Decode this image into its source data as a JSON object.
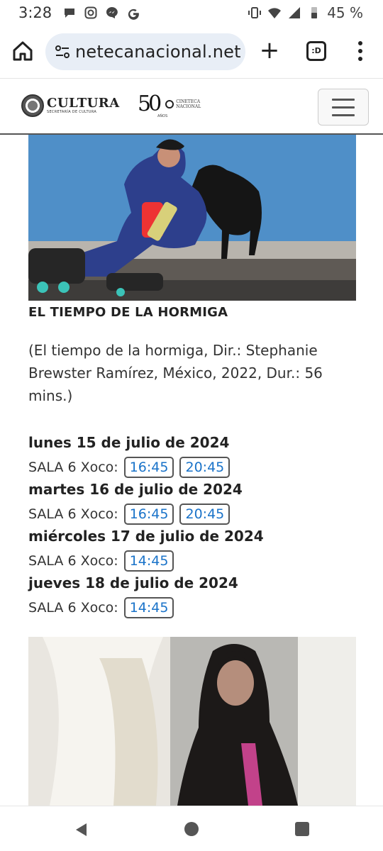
{
  "status_bar": {
    "time": "3:28",
    "left_icons": [
      "chat-bubble-icon",
      "instagram-icon",
      "messenger-icon",
      "google-icon"
    ],
    "battery": "45 %",
    "right_icons": [
      "vibrate-icon",
      "wifi-icon",
      "signal-icon",
      "battery-icon"
    ]
  },
  "browser": {
    "url": "netecanacional.net",
    "tabs_label": ":D"
  },
  "site_header": {
    "logo_main": "CULTURA",
    "logo_sub": "SECRETARÍA DE CULTURA",
    "fifty": "50",
    "anos": "AÑOS",
    "cineteca_line1": "CINETECA",
    "cineteca_line2": "NACIONAL"
  },
  "film": {
    "title": "EL TIEMPO DE LA HORMIGA",
    "info": "(El tiempo de la hormiga, Dir.: Stephanie Brewster Ramírez, México, 2022, Dur.: 56 mins.)",
    "schedule": [
      {
        "day": "lunes 15 de julio de 2024",
        "room": "SALA 6 Xoco:",
        "times": [
          "16:45",
          "20:45"
        ]
      },
      {
        "day": "martes 16 de julio de 2024",
        "room": "SALA 6 Xoco:",
        "times": [
          "16:45",
          "20:45"
        ]
      },
      {
        "day": "miércoles 17 de julio de 2024",
        "room": "SALA 6 Xoco:",
        "times": [
          "14:45"
        ]
      },
      {
        "day": "jueves 18 de julio de 2024",
        "room": "SALA 6 Xoco:",
        "times": [
          "14:45"
        ]
      }
    ]
  },
  "colors": {
    "link_blue": "#1a73c9",
    "url_pill": "#e8eef6",
    "wall_blue": "#4f8fc8"
  }
}
